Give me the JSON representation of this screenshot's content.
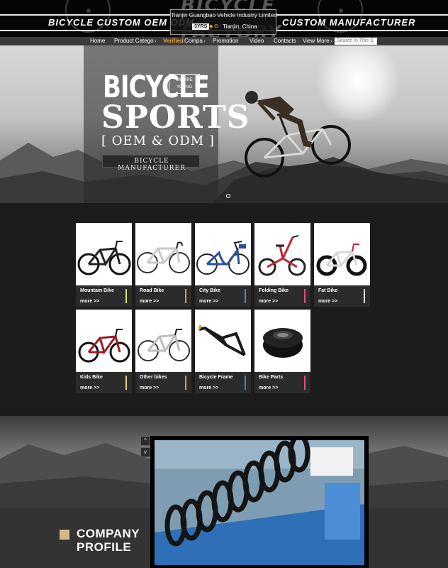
{
  "header": {
    "slogan_left": "BICYCLE CUSTOM OEM ODM",
    "slogan_right": "CUSTOM MANUFACTURER",
    "logo_text_line1": "BICYCLE",
    "logo_text_line2": "FACTORY",
    "company_name": "Tianjin Guangbao Vehicle Industry Limited",
    "years_badge": "3YRS",
    "gold_badge": "G",
    "location": "Tianjin, China"
  },
  "nav": {
    "items": [
      {
        "label": "Home"
      },
      {
        "label": "Product Catego"
      },
      {
        "label": "Compa"
      },
      {
        "label": "Promotion"
      },
      {
        "label": "Video"
      },
      {
        "label": "Contacts"
      },
      {
        "label": "View More"
      }
    ],
    "verified": "Verified",
    "search_placeholder": "Search In This S"
  },
  "banner": {
    "headline1": "BICYCLE",
    "we_are_young": "WE ARE YOUNG",
    "headline2": "SPORTS",
    "headline3": "[ OEM & ODM ]",
    "tagline": "BICYCLE MANUFACTURER"
  },
  "products": [
    {
      "name": "Mountain Bike",
      "more": "more >>",
      "accent": "#e3d56a",
      "icon": "mountain-bike"
    },
    {
      "name": "Road Bike",
      "more": "more >>",
      "accent": "#e89b3b",
      "icon": "road-bike"
    },
    {
      "name": "City Bike",
      "more": "more >>",
      "accent": "#4a84d6",
      "icon": "city-bike"
    },
    {
      "name": "Folding Bike",
      "more": "more >>",
      "accent": "#e24f7a",
      "icon": "folding-bike"
    },
    {
      "name": "Fat Bike",
      "more": "more >>",
      "accent": "#e8e8e8",
      "icon": "fat-bike"
    },
    {
      "name": "Kids Bike",
      "more": "more >>",
      "accent": "#e3d56a",
      "icon": "kids-bike"
    },
    {
      "name": "Other bikes",
      "more": "more >>",
      "accent": "#e89b3b",
      "icon": "other-bike"
    },
    {
      "name": "Bicycle Frame",
      "more": "more >>",
      "accent": "#4a84d6",
      "icon": "bicycle-frame"
    },
    {
      "name": "Bike Parts",
      "more": "more >>",
      "accent": "#e24f7a",
      "icon": "headset-part"
    }
  ],
  "company": {
    "title_line1": "COMPANY",
    "title_line2": "PROFILE",
    "up_arrow": "^",
    "down_arrow": "v",
    "accent": "#d8b888"
  },
  "colors": {
    "gold": "#d9a441",
    "nav_bg": "#3b3b3b",
    "page_bg": "#1c1c1c"
  }
}
